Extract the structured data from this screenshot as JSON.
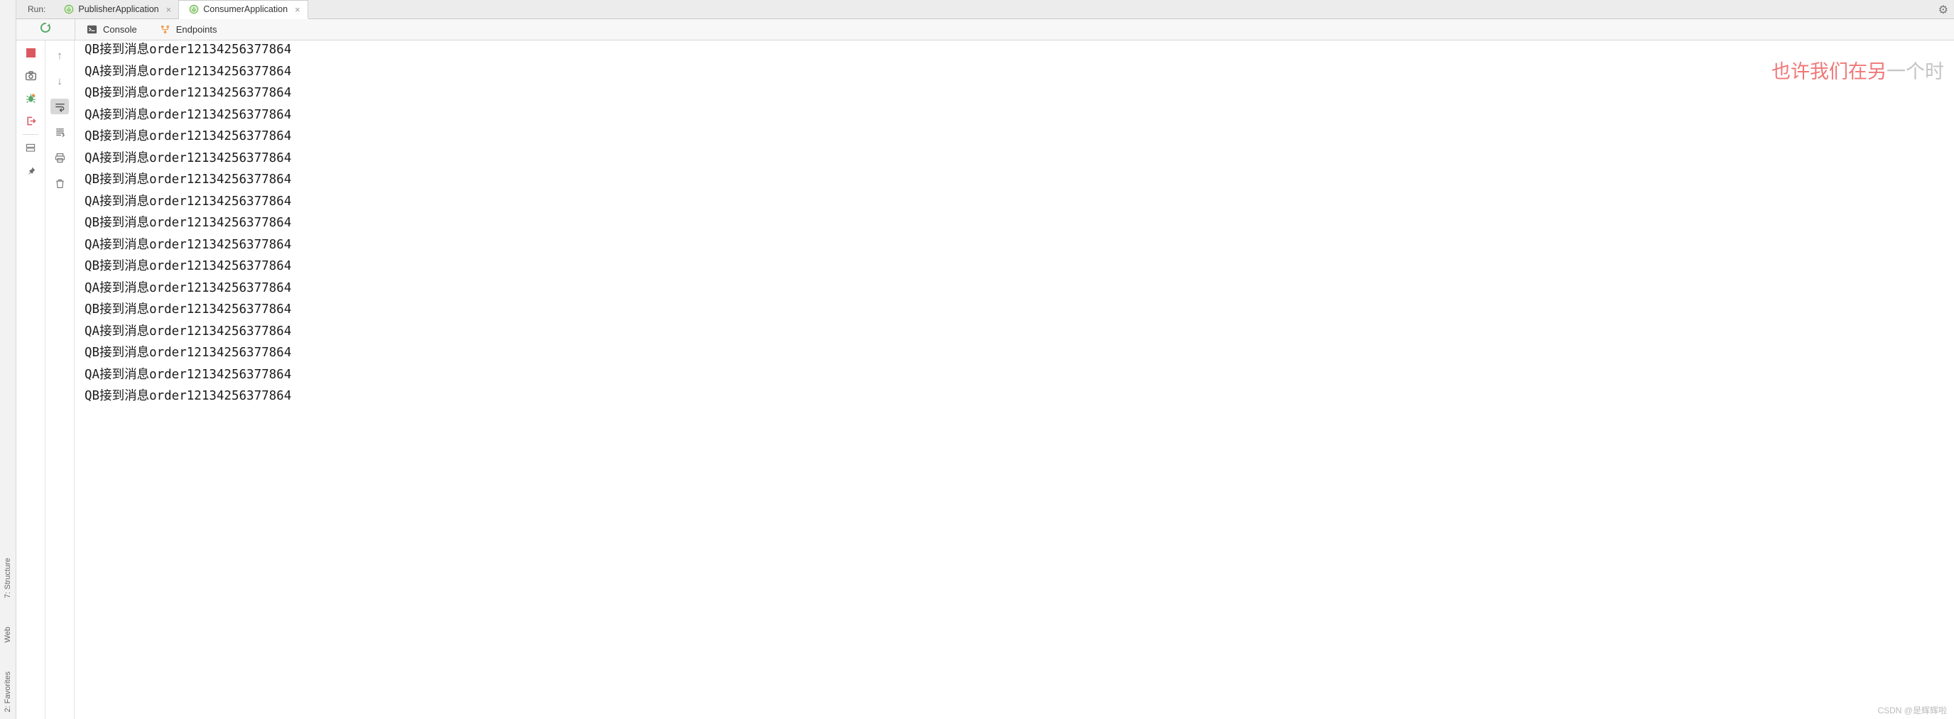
{
  "tabbar": {
    "label": "Run:",
    "tabs": [
      {
        "name": "PublisherApplication",
        "active": false
      },
      {
        "name": "ConsumerApplication",
        "active": true
      }
    ]
  },
  "secondbar": {
    "subtabs": [
      {
        "label": "Console"
      },
      {
        "label": "Endpoints"
      }
    ]
  },
  "sidebar_labels": {
    "structure": "7: Structure",
    "web": "Web",
    "favorites": "2: Favorites"
  },
  "watermark": {
    "red": "也许我们在另",
    "grey": "一个时"
  },
  "footer": "CSDN @是辉辉啦",
  "console_lines": [
    "QB接到消息order12134256377864",
    "QA接到消息order12134256377864",
    "QB接到消息order12134256377864",
    "QA接到消息order12134256377864",
    "QB接到消息order12134256377864",
    "QA接到消息order12134256377864",
    "QB接到消息order12134256377864",
    "QA接到消息order12134256377864",
    "QB接到消息order12134256377864",
    "QA接到消息order12134256377864",
    "QB接到消息order12134256377864",
    "QA接到消息order12134256377864",
    "QB接到消息order12134256377864",
    "QA接到消息order12134256377864",
    "QB接到消息order12134256377864",
    "QA接到消息order12134256377864",
    "QB接到消息order12134256377864"
  ]
}
